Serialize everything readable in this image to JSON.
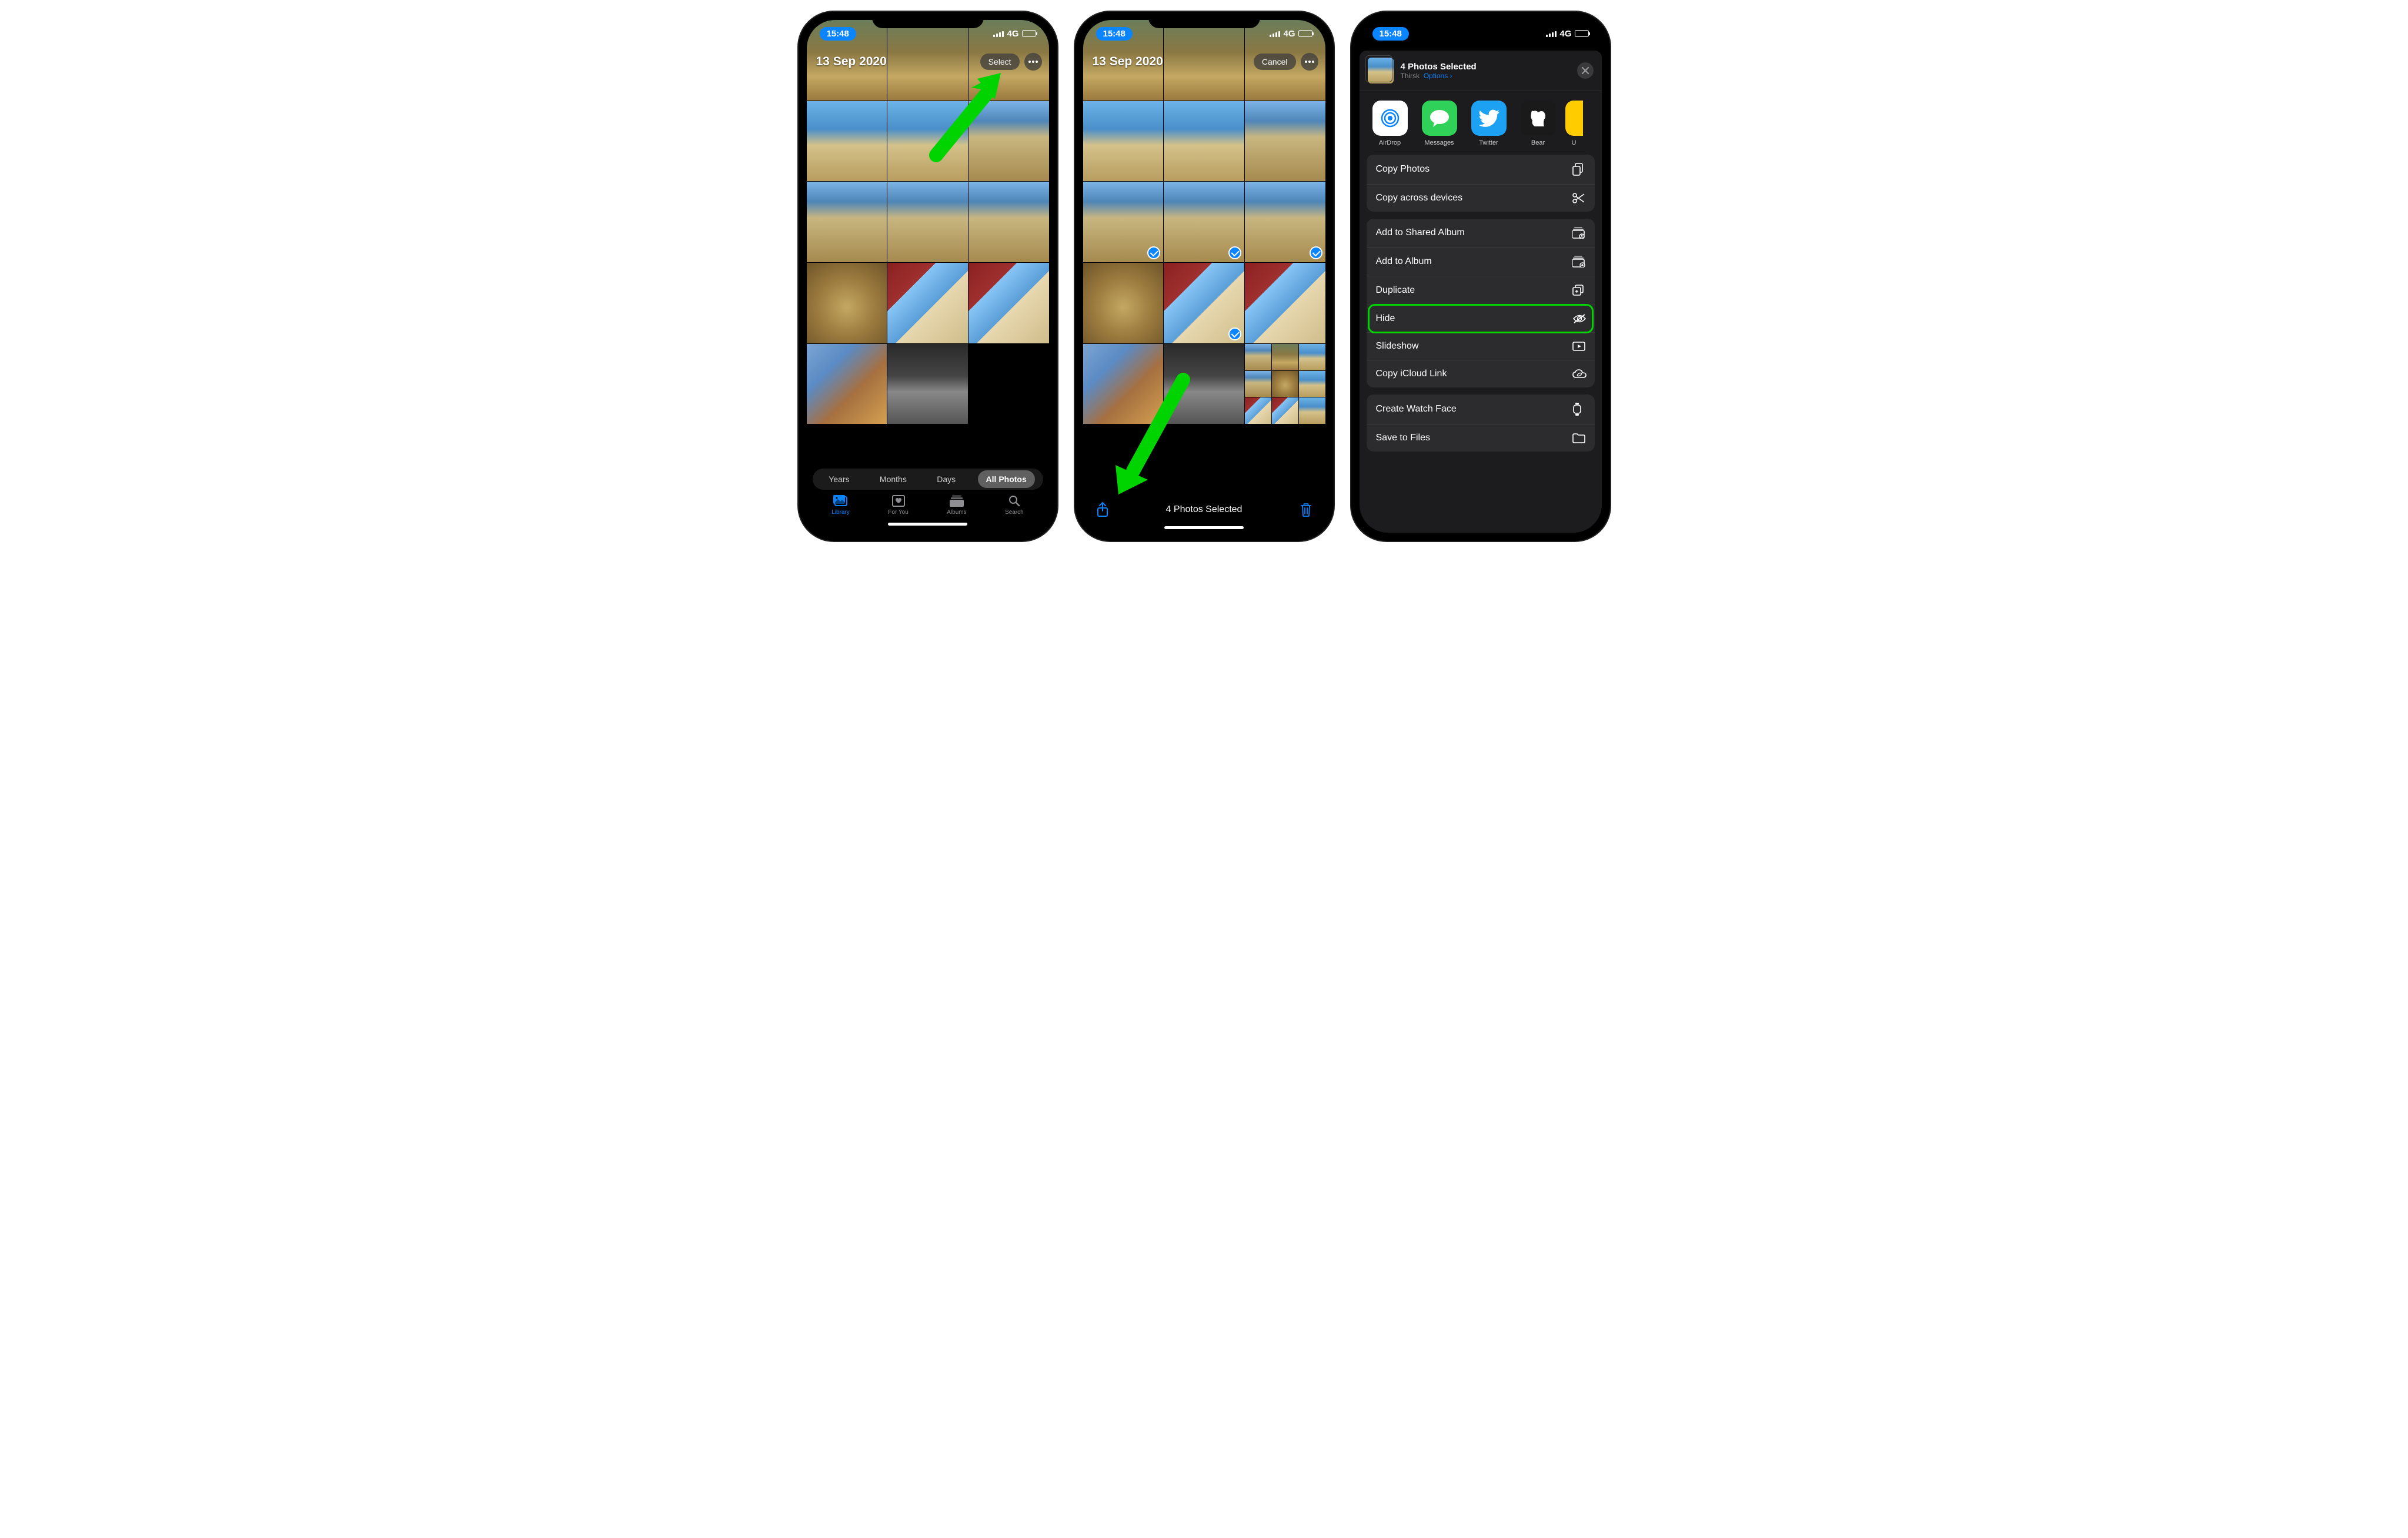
{
  "status": {
    "time": "15:48",
    "network": "4G"
  },
  "screen1": {
    "date": "13 Sep 2020",
    "select": "Select",
    "filters": [
      "Years",
      "Months",
      "Days",
      "All Photos"
    ],
    "active_filter": "All Photos",
    "tabs": [
      {
        "label": "Library",
        "active": true
      },
      {
        "label": "For You",
        "active": false
      },
      {
        "label": "Albums",
        "active": false
      },
      {
        "label": "Search",
        "active": false
      }
    ]
  },
  "screen2": {
    "date": "13 Sep 2020",
    "cancel": "Cancel",
    "selected_label": "4 Photos Selected"
  },
  "screen3": {
    "title": "4 Photos Selected",
    "location": "Thirsk",
    "options_label": "Options",
    "apps": [
      {
        "label": "AirDrop"
      },
      {
        "label": "Messages"
      },
      {
        "label": "Twitter"
      },
      {
        "label": "Bear"
      },
      {
        "label": "U"
      }
    ],
    "group1": [
      "Copy Photos",
      "Copy across devices"
    ],
    "group2": [
      "Add to Shared Album",
      "Add to Album",
      "Duplicate",
      "Hide",
      "Slideshow",
      "Copy iCloud Link"
    ],
    "group3": [
      "Create Watch Face",
      "Save to Files"
    ],
    "highlighted": "Hide"
  }
}
